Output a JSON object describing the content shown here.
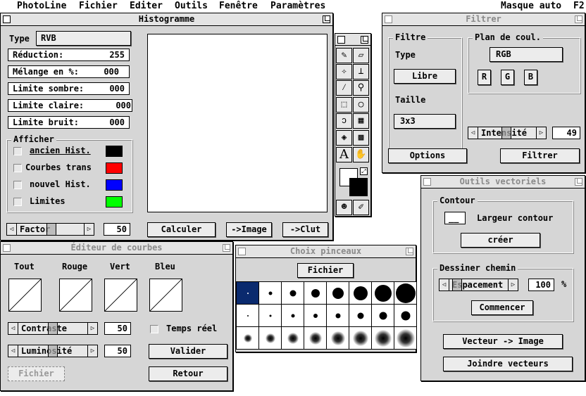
{
  "menubar": {
    "items": [
      "PhotoLine",
      "Fichier",
      "Editer",
      "Outils",
      "Fenêtre",
      "Paramètres"
    ],
    "right_label": "Masque auto",
    "right_key": "F2"
  },
  "histogram": {
    "title": "Histogramme",
    "type_label": "Type",
    "type_value": "RVB",
    "fields": [
      {
        "label": "Réduction:",
        "value": "255"
      },
      {
        "label": "Mélange en %:",
        "value": "000"
      },
      {
        "label": "Limite sombre:",
        "value": "000"
      },
      {
        "label": "Limite claire:",
        "value": "000"
      },
      {
        "label": "Limite bruit:",
        "value": "000"
      }
    ],
    "show_title": "Afficher",
    "show_items": [
      {
        "label": "ancien Hist.",
        "color": "#000000"
      },
      {
        "label": "Courbes trans",
        "color": "#ff0000"
      },
      {
        "label": "nouvel Hist.",
        "color": "#0000ff"
      },
      {
        "label": "Limites",
        "color": "#00ff00"
      }
    ],
    "slider_label": "Factor",
    "slider_value": "50",
    "buttons": [
      "Calculer",
      "->Image",
      "->Clut"
    ]
  },
  "toolbox": {
    "tools": [
      "brush-icon",
      "eraser-icon",
      "wand-icon",
      "stamp-icon",
      "eyedropper-icon",
      "magnifier-icon",
      "rect-select-icon",
      "ellipse-select-icon",
      "lasso-icon",
      "gradient-icon",
      "fill-icon",
      "pattern-icon",
      "text-icon",
      "hand-icon",
      "mask-icon",
      "brush-mask-icon"
    ],
    "text_glyph": "A"
  },
  "filter": {
    "title": "Filtrer",
    "group_filter": "Filtre",
    "type_label": "Type",
    "type_value": "Libre",
    "size_label": "Taille",
    "size_value": "3x3",
    "group_plan": "Plan de coul.",
    "plan_value": "RGB",
    "channels": [
      "R",
      "G",
      "B"
    ],
    "slider_label": "Intensité",
    "slider_value": "49",
    "options_button": "Options",
    "filter_button": "Filtrer"
  },
  "curves": {
    "title": "Éditeur de courbes",
    "channels": [
      "Tout",
      "Rouge",
      "Vert",
      "Bleu"
    ],
    "slider1_label": "Contraste",
    "slider1_value": "50",
    "slider2_label": "Luminosité",
    "slider2_value": "50",
    "realtime_label": "Temps réel",
    "validate_button": "Valider",
    "back_button": "Retour",
    "file_button": "Fichier"
  },
  "brushes": {
    "title": "Choix pinceaux",
    "file_button": "Fichier"
  },
  "vector": {
    "title": "Outils vectoriels",
    "contour_title": "Contour",
    "contour_value": "__",
    "contour_label": "Largeur contour",
    "create_button": "créer",
    "path_title": "Dessiner chemin",
    "slider_label": "Espacement",
    "slider_value": "100",
    "unit": "%",
    "start_button": "Commencer",
    "to_image_button": "Vecteur -> Image",
    "join_button": "Joindre vecteurs"
  }
}
